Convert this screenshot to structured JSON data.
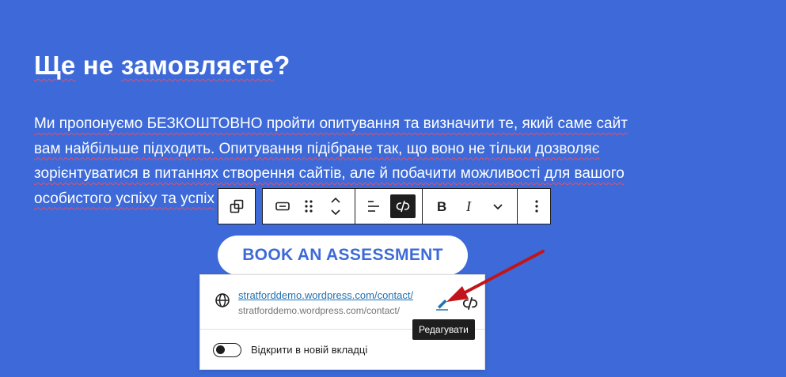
{
  "content": {
    "heading_words": [
      "Ще",
      " не ",
      "замовляєте",
      "?"
    ],
    "paragraph_lines": [
      "Ми пропонуємо БЕЗКОШТОВНО пройти опитування та визначити те, який саме сайт",
      "вам найбільше підходить. Опитування підібране так, що воно не тільки дозволяє",
      "зорієнтуватися в питаннях створення сайтів, але й побачити можливості для вашого",
      "особистого успіху та успіх"
    ],
    "button_label": "BOOK AN ASSESSMENT"
  },
  "toolbar": {
    "groups": [
      [
        {
          "icon": "transform-block-icon"
        }
      ],
      [
        {
          "icon": "button-block-icon"
        },
        {
          "icon": "drag-handle-icon"
        },
        {
          "icon": "move-up-down-icon"
        }
      ],
      [
        {
          "icon": "align-left-icon"
        },
        {
          "icon": "unlink-icon",
          "active": true
        }
      ],
      [
        {
          "icon": "bold-icon",
          "label": "B"
        },
        {
          "icon": "italic-icon",
          "label": "I"
        },
        {
          "icon": "more-formatting-chevron-icon"
        }
      ],
      [
        {
          "icon": "options-kebab-icon"
        }
      ]
    ]
  },
  "link_popover": {
    "url_title": "stratforddemo.wordpress.com/contact/",
    "url_sub": "stratforddemo.wordpress.com/contact/",
    "edit_icon": "pencil-icon",
    "unlink_icon": "unlink-icon",
    "toggle_label": "Відкрити в новій вкладці",
    "toggle_on": false
  },
  "tooltip": {
    "text": "Редагувати"
  },
  "colors": {
    "background": "#3d6ad8",
    "arrow": "#c0161b",
    "link": "#2271b1",
    "dark": "#1e1e1e"
  }
}
